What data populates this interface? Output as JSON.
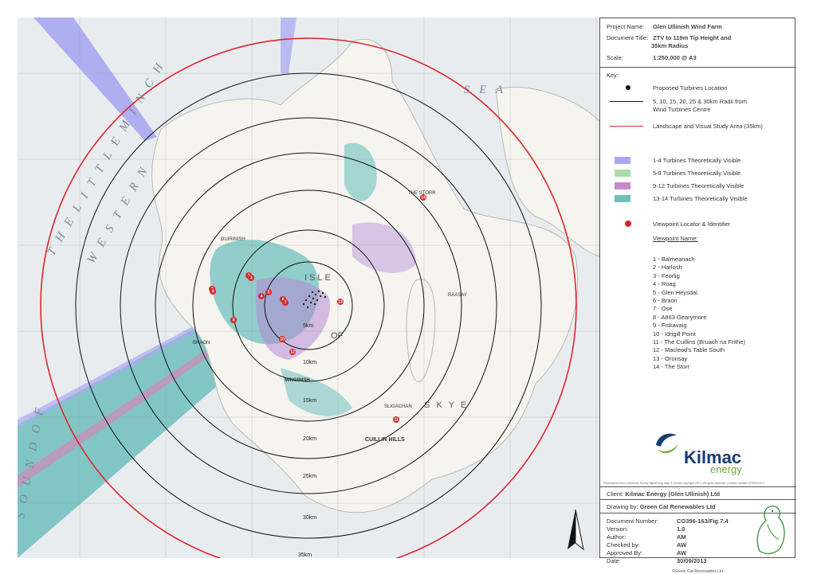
{
  "project": {
    "name_label": "Project Name:",
    "name_value": "Glen Ullinish Wind Farm",
    "title_label": "Document Title:",
    "title_value_1": "ZTV to 119m Tip Height and",
    "title_value_2": "35km Radius",
    "scale_label": "Scale:",
    "scale_value": "1:250,000 @ A3"
  },
  "key": {
    "heading": "Key:",
    "items": [
      {
        "label": "Proposed Turbines Location"
      },
      {
        "label": "5, 10, 15, 20, 25 & 30km Radii from",
        "label2": "Wind Turbines Centre"
      },
      {
        "label": "Landscape and Visual Study Area (35km)"
      }
    ],
    "ztv": [
      {
        "label": "1-4 Turbines Theoretically Visible",
        "color": "#a9a9f0"
      },
      {
        "label": "5-8 Turbines Theoretically Visible",
        "color": "#a8dba8"
      },
      {
        "label": "9-12 Turbines Theoretically Visible",
        "color": "#c98ac9"
      },
      {
        "label": "13-14 Turbines Theoretically Visible",
        "color": "#6fc0bd"
      }
    ],
    "viewpoint_locator": "Viewpoint Locator & Identifier",
    "viewpoint_heading": "Viewpoint Name:",
    "viewpoints": [
      "1 - Balmeanach",
      "2 - Harlosh",
      "3 - Feorlig",
      "4 - Roag",
      "5 - Glen Heysdal",
      "6 - Braon",
      "7 - Ose",
      "8 - A863 Gearymore",
      "9 - Fiskavaig",
      "10 - Idrigill Point",
      "11 - The Cuillins (Bruach na Frithe)",
      "12 - Macleod's Table South",
      "13 - Oronsay",
      "14 - The Storr"
    ]
  },
  "logo": {
    "name": "Kilmac",
    "sub": "energy"
  },
  "copyright": "Reproduced from Ordnance Survey digital map data © Crown copyright 2013. All rights reserved. License number 0100031673",
  "client": {
    "label": "Client:",
    "value": "Kilmac Energy (Glen Ullinish) Ltd"
  },
  "drawing": {
    "label": "Drawing by:",
    "value": "Green Cat Renewables Ltd"
  },
  "document": {
    "number_label": "Document Number:",
    "number_value": "CO396-163/Fig 7.4",
    "version_label": "Version:",
    "version_value": "1.0",
    "author_label": "Author:",
    "author_value": "AM",
    "checked_label": "Checked by:",
    "checked_value": "AW",
    "approved_label": "Approved By:",
    "approved_value": "AW",
    "date_label": "Date:",
    "date_value": "30/09/2013"
  },
  "small_company": "©Green Cat Renewables Ltd",
  "map": {
    "sea_labels": [
      "W E S T E R N",
      "T H E   L I T T L E   M I N C H",
      "S O U N D   O F",
      "S E A"
    ],
    "radius_labels": [
      "5km",
      "10km",
      "15km",
      "20km",
      "25km",
      "30km",
      "35km"
    ],
    "place_labels": [
      "THE STORR",
      "CUILLIN HILLS",
      "MINGINISH",
      "RAASAY",
      "SLIGACHAN",
      "BRAON",
      "ISLE",
      "OF",
      "SKYE",
      "DUIRINISH"
    ],
    "north_label": "N",
    "colors": {
      "study_area": "#e0262b",
      "ztv_teal": "#6fc0bd",
      "ztv_purple": "#b58ad6",
      "viewpoint": "#d62828"
    }
  }
}
